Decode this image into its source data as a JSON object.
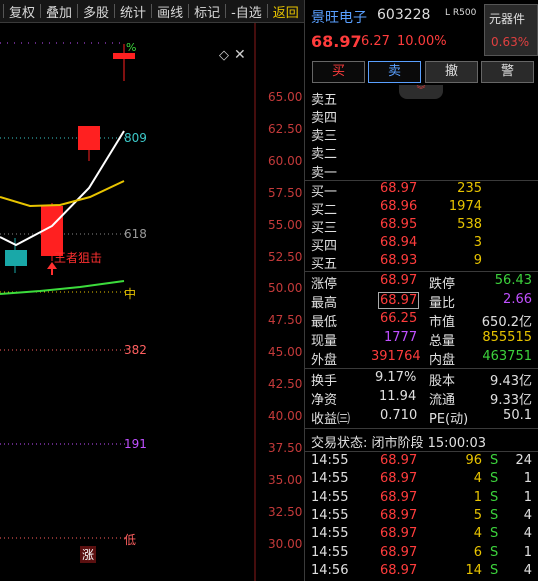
{
  "toolbar": {
    "items": [
      {
        "label": "复权"
      },
      {
        "label": "叠加"
      },
      {
        "label": "多股"
      },
      {
        "label": "统计"
      },
      {
        "label": "画线"
      },
      {
        "label": "标记"
      },
      {
        "label": "-自选"
      },
      {
        "label": "返回"
      }
    ]
  },
  "chart": {
    "price_axis": [
      "65.00",
      "62.50",
      "60.00",
      "57.50",
      "55.00",
      "52.50",
      "50.00",
      "47.50",
      "45.00",
      "42.50",
      "40.00",
      "37.50",
      "35.00",
      "32.50",
      "30.00"
    ],
    "fib_labels": {
      "l809": "809",
      "l618": "618",
      "mid": "中",
      "l382": "382",
      "l191": "191",
      "low": "低"
    },
    "annotation": "王者狙击",
    "bottom_marker": "涨",
    "top_marker": "%",
    "colors": {
      "up": "#ff2020",
      "down": "#19a8a8",
      "ma1": "#ffffff",
      "ma2": "#e8c400",
      "ma3": "#3cdc3c"
    }
  },
  "quote": {
    "name": "景旺电子",
    "code": "603228",
    "tags": "L R500",
    "sector_name": "元器件",
    "sector_pct": "0.63%",
    "price": "68.97",
    "change": "6.27",
    "change_pct": "10.00%",
    "buttons": {
      "buy": "买",
      "sell": "卖",
      "cancel": "撤",
      "alert": "警"
    },
    "collapse_icon": "double-chevron-down"
  },
  "order_book": {
    "asks": [
      {
        "label": "卖五"
      },
      {
        "label": "卖四"
      },
      {
        "label": "卖三"
      },
      {
        "label": "卖二"
      },
      {
        "label": "卖一"
      }
    ],
    "bids": [
      {
        "label": "买一",
        "price": "68.97",
        "vol": "235"
      },
      {
        "label": "买二",
        "price": "68.96",
        "vol": "1974"
      },
      {
        "label": "买三",
        "price": "68.95",
        "vol": "538"
      },
      {
        "label": "买四",
        "price": "68.94",
        "vol": "3"
      },
      {
        "label": "买五",
        "price": "68.93",
        "vol": "9"
      }
    ]
  },
  "stats": {
    "limit_up_label": "涨停",
    "limit_up": "68.97",
    "limit_down_label": "跌停",
    "limit_down": "56.43",
    "high_label": "最高",
    "high": "68.97",
    "vol_ratio_label": "量比",
    "vol_ratio": "2.66",
    "low_label": "最低",
    "low": "66.25",
    "mcap_label": "市值",
    "mcap": "650.2亿",
    "cur_vol_label": "现量",
    "cur_vol": "1777",
    "total_vol_label": "总量",
    "total_vol": "855515",
    "outer_label": "外盘",
    "outer": "391764",
    "inner_label": "内盘",
    "inner": "463751"
  },
  "fund": {
    "turnover_label": "换手",
    "turnover": "9.17%",
    "equity_label": "股本",
    "equity": "9.43亿",
    "nav_label": "净资",
    "nav": "11.94",
    "float_label": "流通",
    "float": "9.33亿",
    "eps_label": "收益㈢",
    "eps": "0.710",
    "pe_label": "PE(动)",
    "pe": "50.1"
  },
  "trade_status": "交易状态: 闭市阶段 15:00:03",
  "ticks": [
    {
      "time": "14:55",
      "price": "68.97",
      "vol": "96",
      "side": "S",
      "n": "24"
    },
    {
      "time": "14:55",
      "price": "68.97",
      "vol": "4",
      "side": "S",
      "n": "1"
    },
    {
      "time": "14:55",
      "price": "68.97",
      "vol": "1",
      "side": "S",
      "n": "1"
    },
    {
      "time": "14:55",
      "price": "68.97",
      "vol": "5",
      "side": "S",
      "n": "4"
    },
    {
      "time": "14:55",
      "price": "68.97",
      "vol": "4",
      "side": "S",
      "n": "4"
    },
    {
      "time": "14:55",
      "price": "68.97",
      "vol": "6",
      "side": "S",
      "n": "1"
    },
    {
      "time": "14:56",
      "price": "68.97",
      "vol": "14",
      "side": "S",
      "n": "4"
    }
  ]
}
